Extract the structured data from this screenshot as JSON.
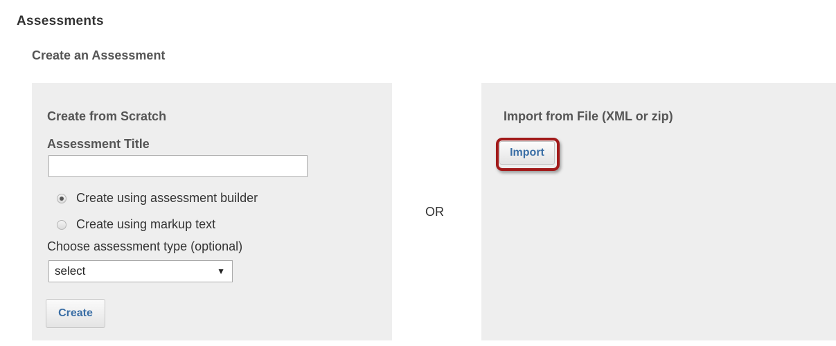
{
  "page": {
    "heading": "Assessments",
    "subheading": "Create an Assessment",
    "or_label": "OR"
  },
  "scratch": {
    "title": "Create from Scratch",
    "field_label": "Assessment Title",
    "title_value": "",
    "radio_builder": "Create using assessment builder",
    "radio_markup": "Create using markup text",
    "selected_method": "builder",
    "type_label": "Choose assessment type (optional)",
    "type_selected": "select",
    "create_button": "Create"
  },
  "import": {
    "title": "Import from File (XML or zip)",
    "import_button": "Import",
    "highlight_color": "#a11a1a"
  },
  "colors": {
    "panel_bg": "#eeeeee",
    "button_text": "#3a6ea5"
  }
}
